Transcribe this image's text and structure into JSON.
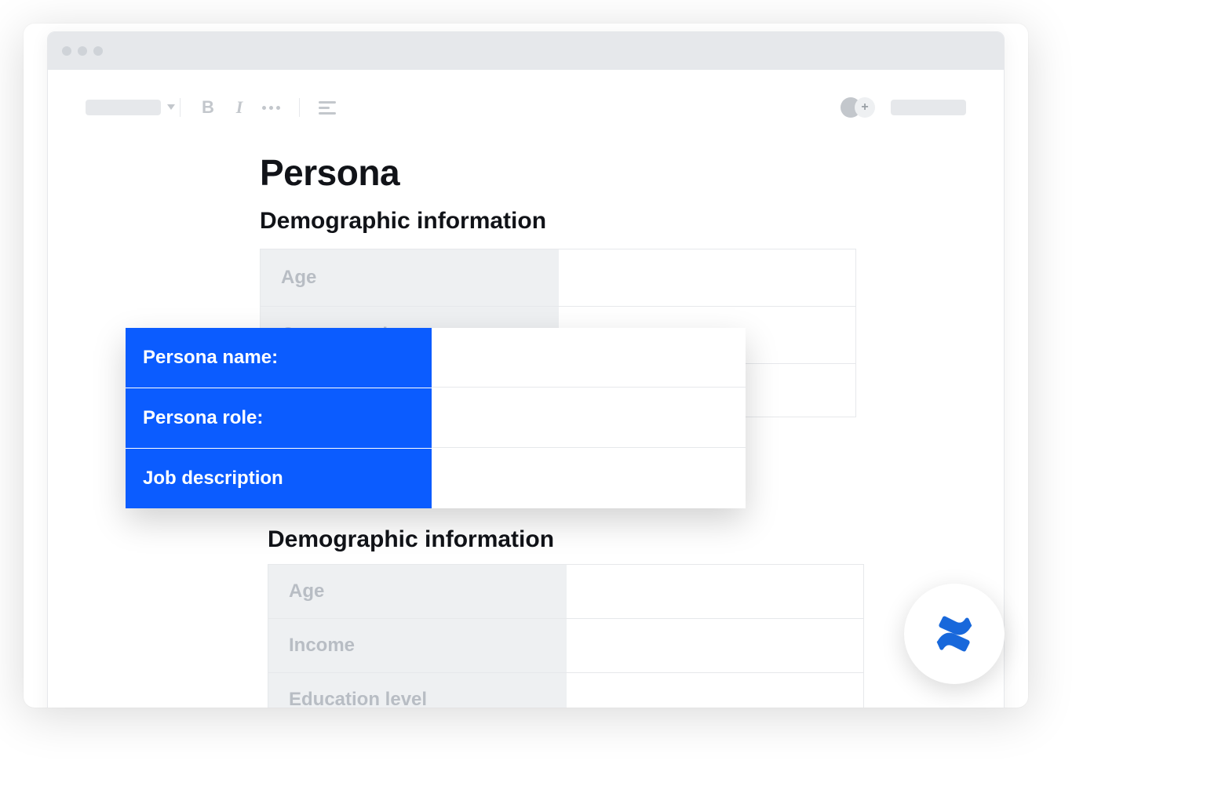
{
  "page": {
    "title": "Persona"
  },
  "sections": [
    {
      "heading": "Demographic information",
      "rows": [
        "Age",
        "Company size"
      ]
    },
    {
      "heading": "Demographic information",
      "rows": [
        "Age",
        "Income",
        "Education level"
      ]
    }
  ],
  "overlay": {
    "rows": [
      "Persona name:",
      "Persona role:",
      "Job description"
    ]
  },
  "toolbar": {
    "bold_glyph": "B",
    "italic_glyph": "I",
    "add_glyph": "+"
  }
}
